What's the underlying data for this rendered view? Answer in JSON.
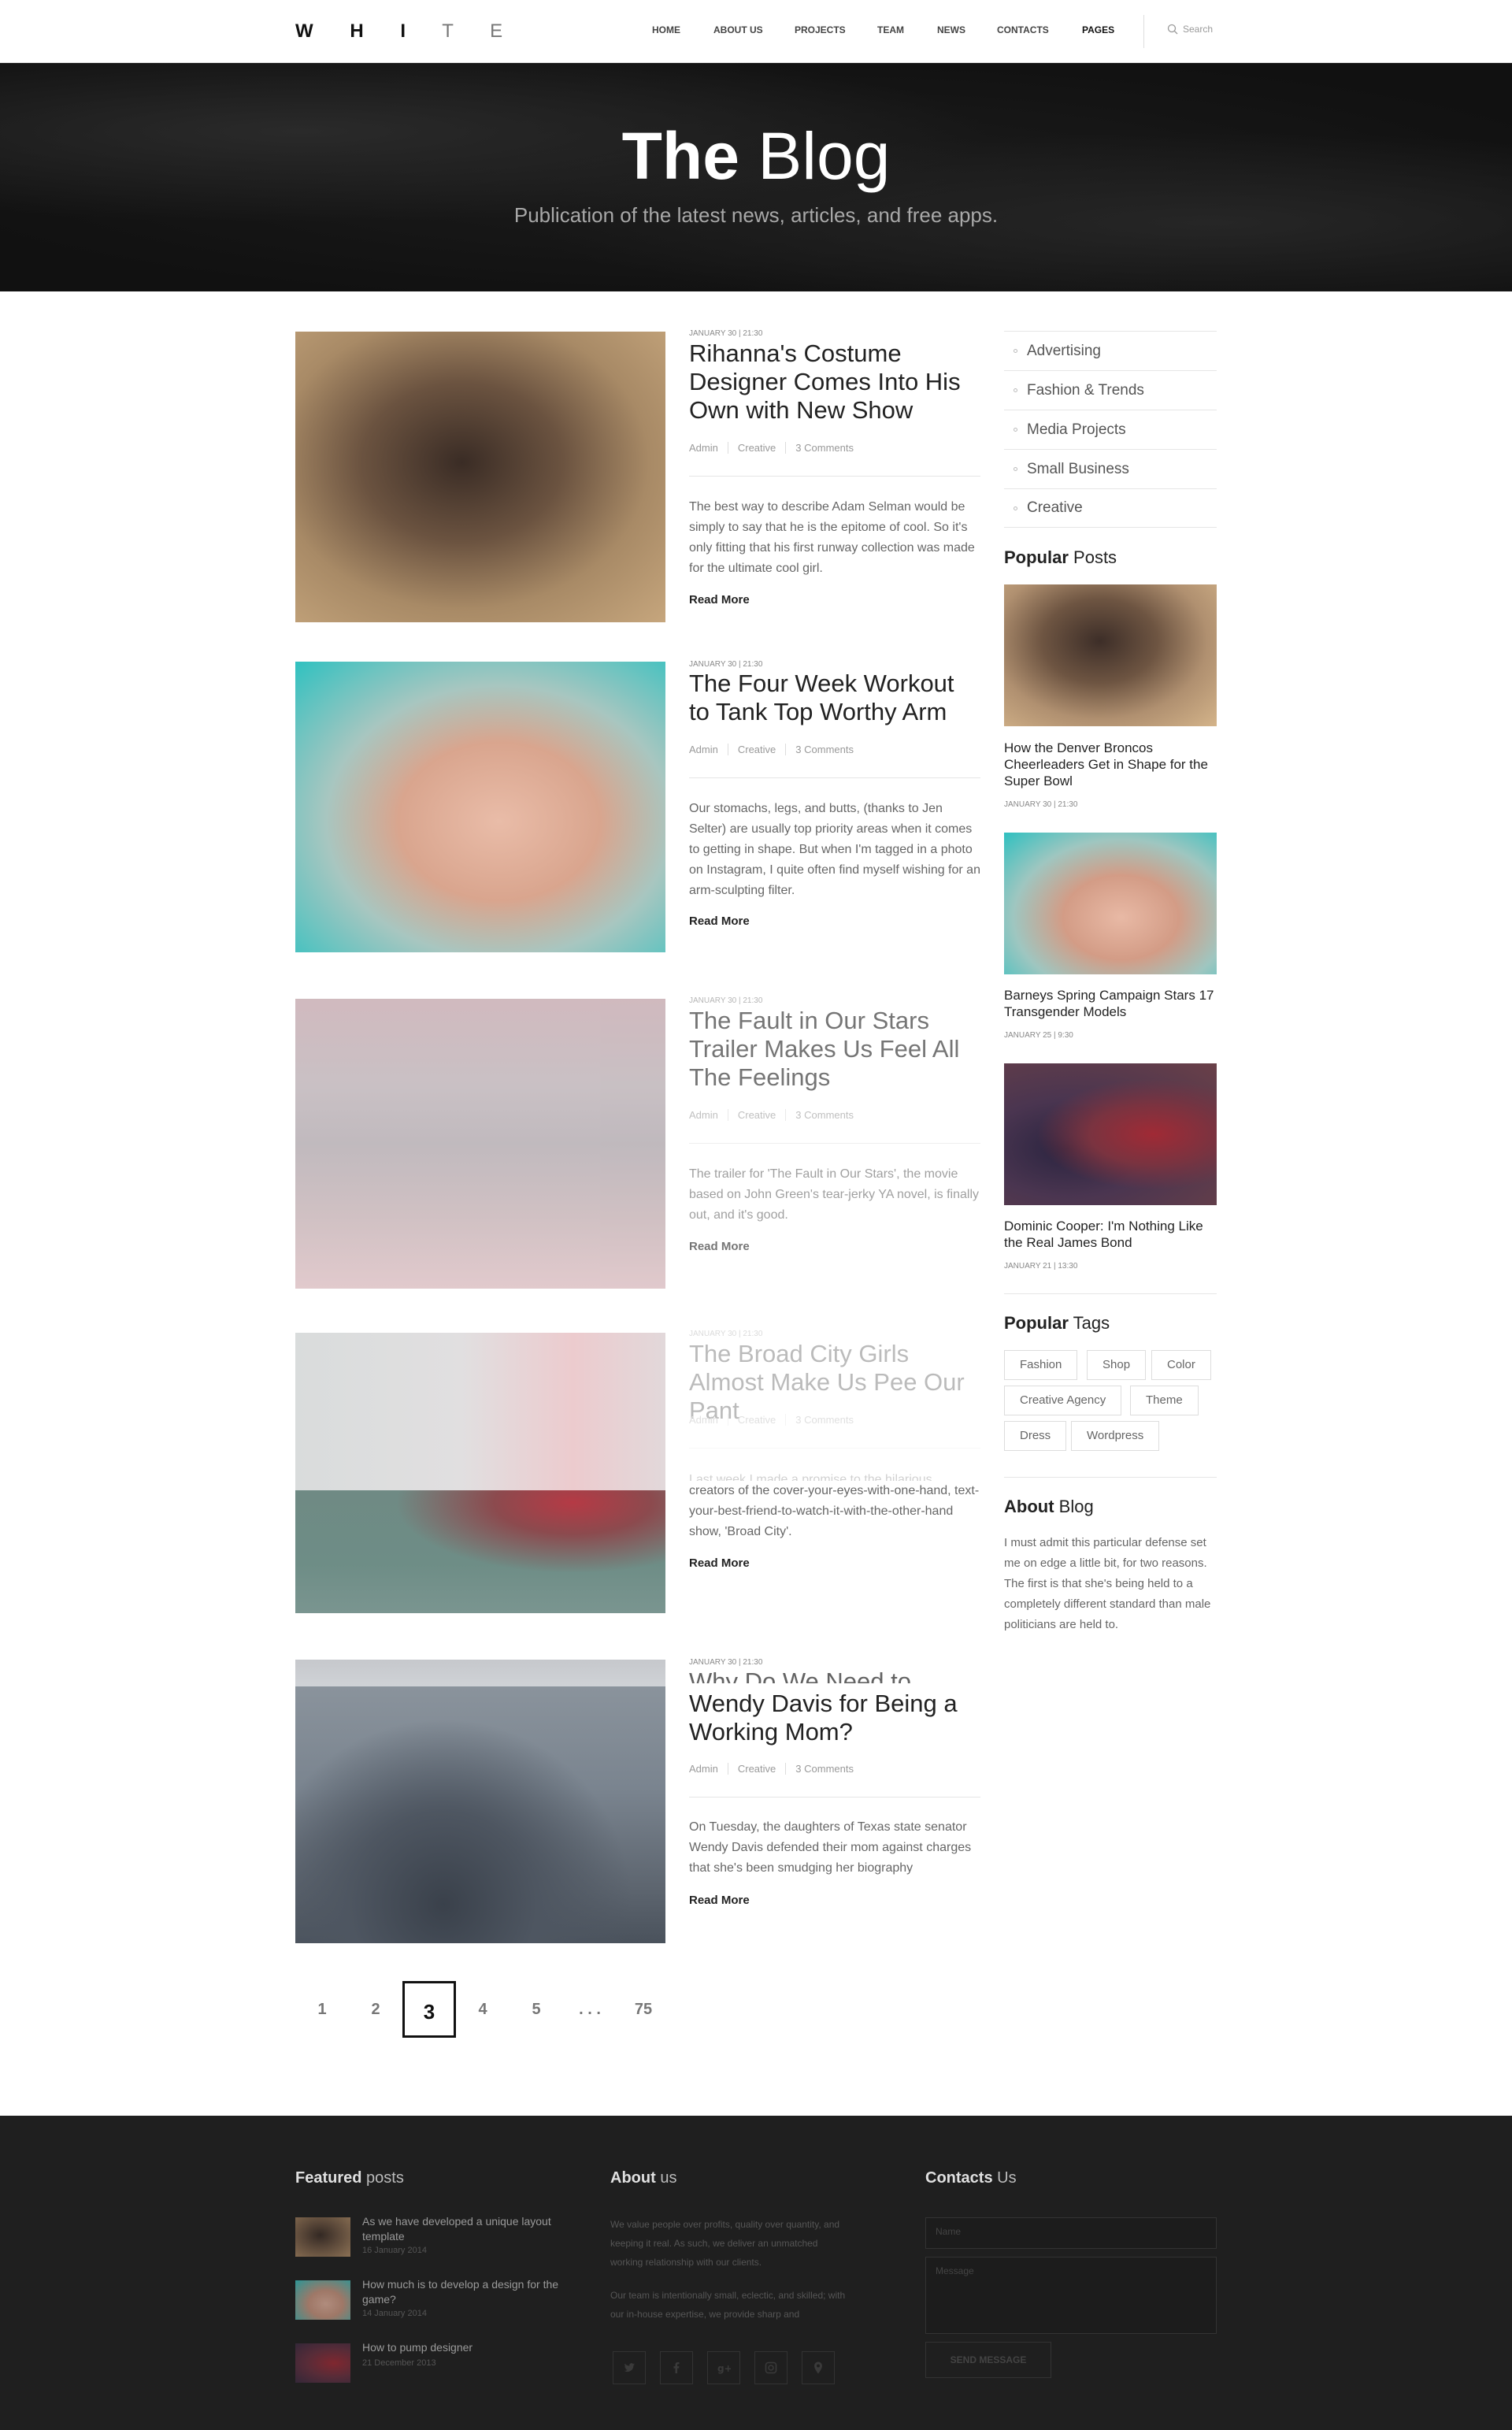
{
  "header": {
    "logo_bold": "W H I",
    "logo_light": "T E",
    "nav": [
      "HOME",
      "ABOUT US",
      "PROJECTS",
      "TEAM",
      "NEWS",
      "CONTACTS",
      "PAGES"
    ],
    "search_placeholder": "Search"
  },
  "hero": {
    "title_bold": "The",
    "title_light": "Blog",
    "subtitle": "Publication of the latest news, articles, and free apps."
  },
  "posts": [
    {
      "date": "JANUARY 30 | 21:30",
      "title": "Rihanna's Costume Designer Comes Into His Own with New Show",
      "author": "Admin",
      "category": "Creative",
      "comments": "3 Comments",
      "excerpt": "The best way to describe Adam Selman would be simply to say that he is the epitome of cool. So it's only fitting that his first runway collection was made for the ultimate cool girl.",
      "read_more": "Read More"
    },
    {
      "date": "JANUARY 30 | 21:30",
      "title": "The Four Week Workout to Tank Top Worthy Arm",
      "author": "Admin",
      "category": "Creative",
      "comments": "3 Comments",
      "excerpt": "Our stomachs, legs, and butts, (thanks to Jen Selter) are usually top priority areas when it comes to getting in shape. But when I'm tagged in a photo on Instagram, I quite often find myself wishing for an arm-sculpting filter.",
      "read_more": "Read More"
    },
    {
      "date": "JANUARY 30 | 21:30",
      "title": "The Fault in Our Stars Trailer Makes Us Feel All The Feelings",
      "author": "Admin",
      "category": "Creative",
      "comments": "3 Comments",
      "excerpt": "The trailer for 'The Fault in Our Stars', the movie based on John Green's tear-jerky YA novel, is finally out, and it's good.",
      "read_more": "Read More"
    },
    {
      "date": "JANUARY 30 | 21:30",
      "title": "The Broad City Girls Almost Make Us Pee Our Pant",
      "author": "Admin",
      "category": "Creative",
      "comments": "3 Comments",
      "excerpt_faded": "Last week I made a promise to the hilarious",
      "excerpt": "creators of the cover-your-eyes-with-one-hand, text-your-best-friend-to-watch-it-with-the-other-hand show, 'Broad City'.",
      "read_more": "Read More"
    },
    {
      "date": "JANUARY 30 | 21:30",
      "title_faded": "Why Do We Need to Defend",
      "title": "Wendy Davis for Being a Working Mom?",
      "author": "Admin",
      "category": "Creative",
      "comments": "3 Comments",
      "excerpt": "On Tuesday, the daughters of Texas state senator Wendy Davis defended their mom against charges that she's been smudging her biography",
      "read_more": "Read More"
    }
  ],
  "pagination": [
    "1",
    "2",
    "3",
    "4",
    "5",
    ". . .",
    "75"
  ],
  "sidebar": {
    "categories": [
      "Advertising",
      "Fashion & Trends",
      "Media Projects",
      "Small Business",
      "Creative"
    ],
    "popular_posts_bold": "Popular",
    "popular_posts_light": "Posts",
    "popular": [
      {
        "title": "How the Denver Broncos Cheerleaders Get in Shape for the Super Bowl",
        "date": "JANUARY 30 | 21:30"
      },
      {
        "title": "Barneys Spring Campaign Stars 17 Transgender Models",
        "date": "JANUARY 25 | 9:30"
      },
      {
        "title": "Dominic Cooper: I'm Nothing Like the Real James Bond",
        "date": "JANUARY 21 | 13:30"
      }
    ],
    "tags_bold": "Popular",
    "tags_light": "Tags",
    "tags": [
      "Fashion",
      "Shop",
      "Color",
      "Creative Agency",
      "Theme",
      "Dress",
      "Wordpress"
    ],
    "about_bold": "About",
    "about_light": "Blog",
    "about_text": "I must admit this particular defense set me on edge a little bit, for two reasons. The first is that she's being held to a completely different standard than male politicians are held to."
  },
  "footer": {
    "featured_bold": "Featured",
    "featured_light": "posts",
    "featured": [
      {
        "title": "As we have developed a unique layout template",
        "date": "16 January 2014"
      },
      {
        "title": "How much is to develop a design for the game?",
        "date": "14 January 2014"
      },
      {
        "title": "How to pump designer",
        "date": "21 December 2013"
      }
    ],
    "about_bold": "About",
    "about_light": "us",
    "about_p1": "We value people over profits, quality over quantity, and keeping it real. As such, we deliver an unmatched working relationship with our clients.",
    "about_p2": "Our team is intentionally small, eclectic, and skilled; with our in-house expertise, we provide sharp and",
    "social_icons": [
      "twitter-icon",
      "facebook-icon",
      "google-plus-icon",
      "instagram-icon",
      "map-pin-icon"
    ],
    "contacts_bold": "Contacts",
    "contacts_light": "Us",
    "name_placeholder": "Name",
    "message_placeholder": "Message",
    "send_label": "SEND MESSAGE"
  }
}
